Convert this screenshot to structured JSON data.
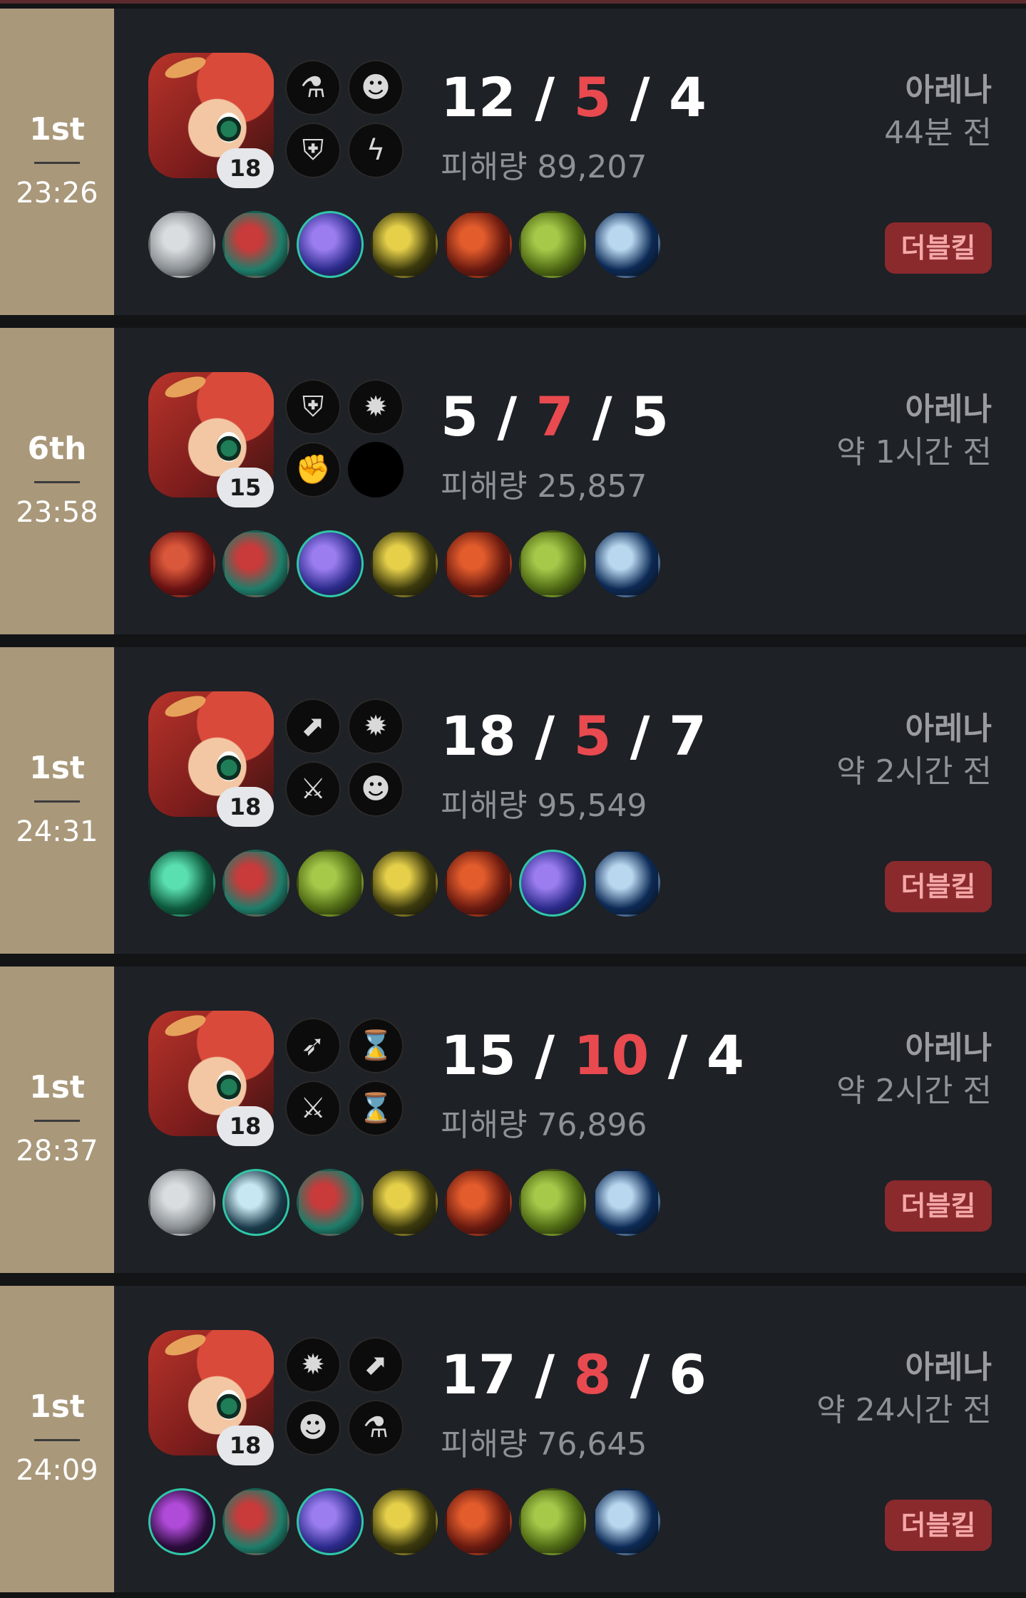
{
  "matches": [
    {
      "place": "1st",
      "duration": "23:26",
      "level": "18",
      "kills": "12",
      "deaths": "5",
      "assists": "4",
      "damage": "피해량 89,207",
      "mode": "아레나",
      "ago": "44분 전",
      "badge": "더블킬",
      "runes": [
        "magic-potion-icon",
        "pet-icon",
        "shield-rune-icon",
        "lightning-rune-icon"
      ],
      "items": [
        {
          "name": "blade-item",
          "colors": [
            "#8a8f93",
            "#d9dde0"
          ],
          "ring": false
        },
        {
          "name": "boots-item",
          "colors": [
            "#1e7d6a",
            "#c93a3a"
          ],
          "ring": false
        },
        {
          "name": "arrow-item",
          "colors": [
            "#2a2a8a",
            "#9b7df0"
          ],
          "ring": true
        },
        {
          "name": "sword-item",
          "colors": [
            "#3c3a0c",
            "#e6d04a"
          ],
          "ring": false
        },
        {
          "name": "gauntlet-item",
          "colors": [
            "#6a1a10",
            "#e25c2c"
          ],
          "ring": false
        },
        {
          "name": "bow-item",
          "colors": [
            "#4f6a14",
            "#a7c94a"
          ],
          "ring": false
        },
        {
          "name": "eye-item",
          "colors": [
            "#0c2a55",
            "#b9d8f0"
          ],
          "ring": false
        }
      ]
    },
    {
      "place": "6th",
      "duration": "23:58",
      "level": "15",
      "kills": "5",
      "deaths": "7",
      "assists": "5",
      "damage": "피해량 25,857",
      "mode": "아레나",
      "ago": "약 1시간 전",
      "badge": "",
      "runes": [
        "shield-rune-icon",
        "burst-icon",
        "fist-icon",
        "empty"
      ],
      "items": [
        {
          "name": "greatsword-item",
          "colors": [
            "#6a1212",
            "#d9573a"
          ],
          "ring": false
        },
        {
          "name": "boots-item",
          "colors": [
            "#1e7d6a",
            "#c93a3a"
          ],
          "ring": false
        },
        {
          "name": "arrow-item",
          "colors": [
            "#2a2a8a",
            "#9b7df0"
          ],
          "ring": true
        },
        {
          "name": "sword-item",
          "colors": [
            "#3c3a0c",
            "#e6d04a"
          ],
          "ring": false
        },
        {
          "name": "gauntlet-item",
          "colors": [
            "#6a1a10",
            "#e25c2c"
          ],
          "ring": false
        },
        {
          "name": "bow-item",
          "colors": [
            "#4f6a14",
            "#a7c94a"
          ],
          "ring": false
        },
        {
          "name": "eye-item",
          "colors": [
            "#0c2a55",
            "#b9d8f0"
          ],
          "ring": false
        }
      ]
    },
    {
      "place": "1st",
      "duration": "24:31",
      "level": "18",
      "kills": "18",
      "deaths": "5",
      "assists": "7",
      "damage": "피해량 95,549",
      "mode": "아레나",
      "ago": "약 2시간 전",
      "badge": "더블킬",
      "runes": [
        "growth-icon",
        "burst-icon",
        "crossed-swords-icon",
        "pet-icon"
      ],
      "items": [
        {
          "name": "emerald-sword-item",
          "colors": [
            "#0e5a3e",
            "#5ae0b0"
          ],
          "ring": false
        },
        {
          "name": "boots-item",
          "colors": [
            "#1e7d6a",
            "#c93a3a"
          ],
          "ring": false
        },
        {
          "name": "bow-item",
          "colors": [
            "#4f6a14",
            "#a7c94a"
          ],
          "ring": false
        },
        {
          "name": "sword-item",
          "colors": [
            "#3c3a0c",
            "#e6d04a"
          ],
          "ring": false
        },
        {
          "name": "gauntlet-item",
          "colors": [
            "#6a1a10",
            "#e25c2c"
          ],
          "ring": false
        },
        {
          "name": "arrow-item",
          "colors": [
            "#2a2a8a",
            "#9b7df0"
          ],
          "ring": true
        },
        {
          "name": "eye-item",
          "colors": [
            "#0c2a55",
            "#b9d8f0"
          ],
          "ring": false
        }
      ]
    },
    {
      "place": "1st",
      "duration": "28:37",
      "level": "18",
      "kills": "15",
      "deaths": "10",
      "assists": "4",
      "damage": "피해량 76,896",
      "mode": "아레나",
      "ago": "약 2시간 전",
      "badge": "더블킬",
      "runes": [
        "arrow-up-icon",
        "hourglass-icon",
        "crossed-swords-icon",
        "hourglass-icon"
      ],
      "items": [
        {
          "name": "blade-item",
          "colors": [
            "#8a8f93",
            "#d9dde0"
          ],
          "ring": false
        },
        {
          "name": "silver-blade-item",
          "colors": [
            "#1a3a4a",
            "#c7e7f2"
          ],
          "ring": true
        },
        {
          "name": "boots-item",
          "colors": [
            "#1e7d6a",
            "#c93a3a"
          ],
          "ring": false
        },
        {
          "name": "sword-item",
          "colors": [
            "#3c3a0c",
            "#e6d04a"
          ],
          "ring": false
        },
        {
          "name": "gauntlet-item",
          "colors": [
            "#6a1a10",
            "#e25c2c"
          ],
          "ring": false
        },
        {
          "name": "bow-item",
          "colors": [
            "#4f6a14",
            "#a7c94a"
          ],
          "ring": false
        },
        {
          "name": "eye-item",
          "colors": [
            "#0c2a55",
            "#b9d8f0"
          ],
          "ring": false
        }
      ]
    },
    {
      "place": "1st",
      "duration": "24:09",
      "level": "18",
      "kills": "17",
      "deaths": "8",
      "assists": "6",
      "damage": "피해량 76,645",
      "mode": "아레나",
      "ago": "약 24시간 전",
      "badge": "더블킬",
      "runes": [
        "burst-icon",
        "growth-icon",
        "pet-icon",
        "magic-potion-icon"
      ],
      "items": [
        {
          "name": "shadow-item",
          "colors": [
            "#2a0c3a",
            "#b04ad9"
          ],
          "ring": true
        },
        {
          "name": "boots-item",
          "colors": [
            "#1e7d6a",
            "#c93a3a"
          ],
          "ring": false
        },
        {
          "name": "arrow-item",
          "colors": [
            "#2a2a8a",
            "#9b7df0"
          ],
          "ring": true
        },
        {
          "name": "sword-item",
          "colors": [
            "#3c3a0c",
            "#e6d04a"
          ],
          "ring": false
        },
        {
          "name": "gauntlet-item",
          "colors": [
            "#6a1a10",
            "#e25c2c"
          ],
          "ring": false
        },
        {
          "name": "bow-item",
          "colors": [
            "#4f6a14",
            "#a7c94a"
          ],
          "ring": false
        },
        {
          "name": "eye-item",
          "colors": [
            "#0c2a55",
            "#b9d8f0"
          ],
          "ring": false
        }
      ]
    }
  ]
}
